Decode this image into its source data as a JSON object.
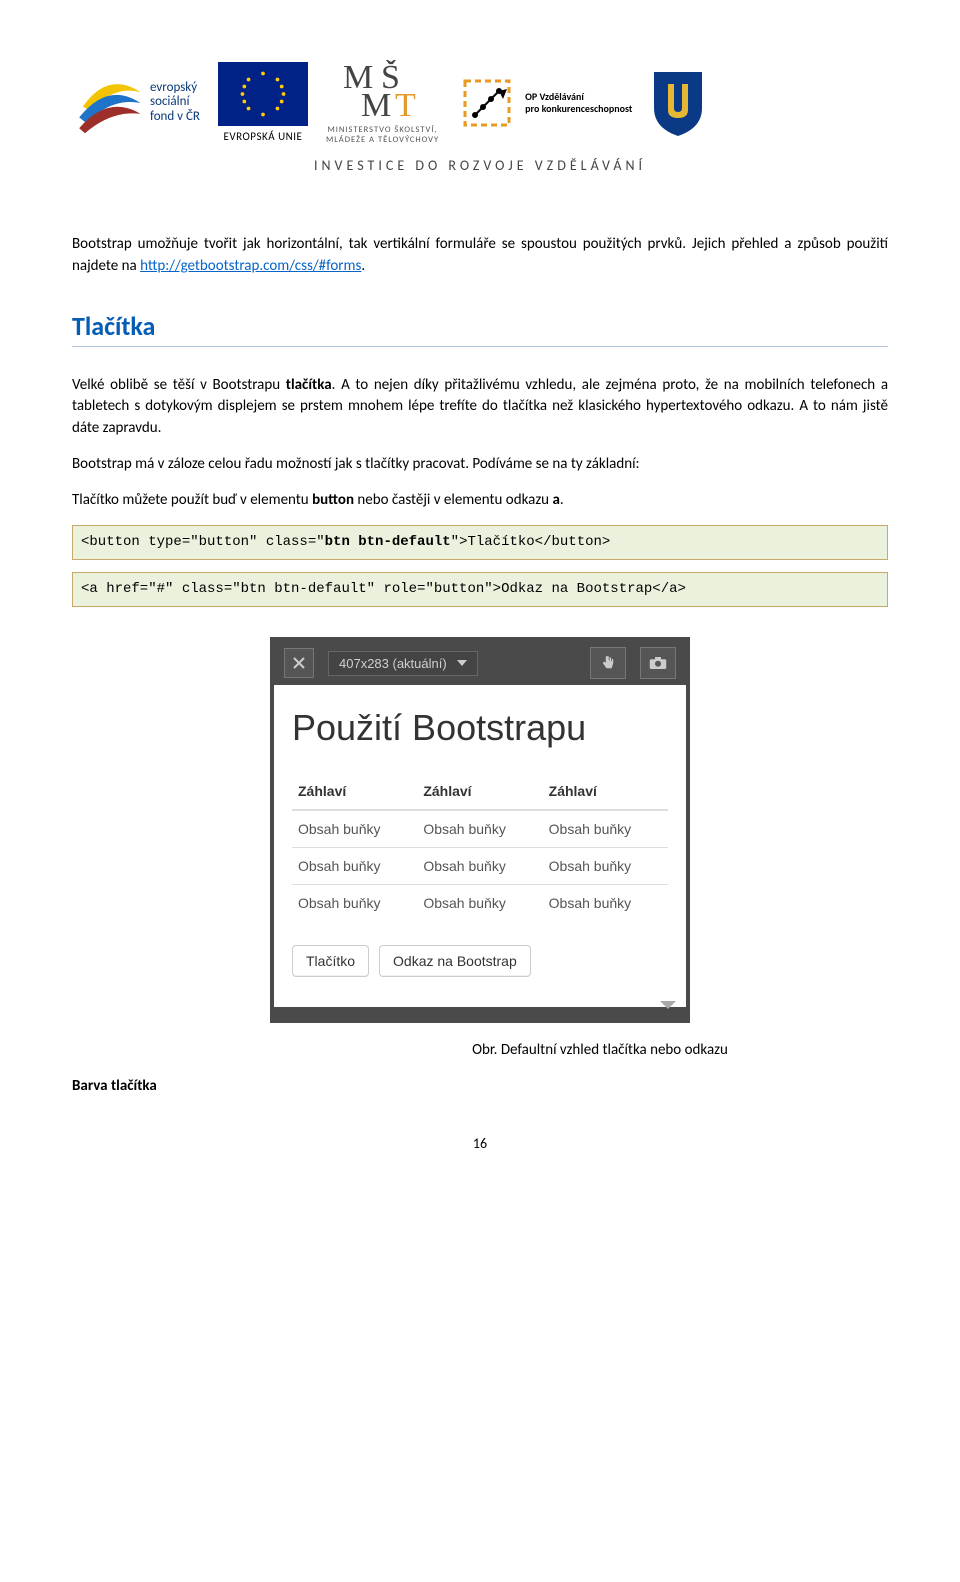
{
  "header": {
    "esf": {
      "line1": "evropský",
      "line2": "sociální",
      "line3": "fond v ČR"
    },
    "eu_label": "EVROPSKÁ UNIE",
    "msmt": {
      "line1": "MINISTERSTVO ŠKOLSTVÍ,",
      "line2": "MLÁDEŽE A TĚLOVÝCHOVY"
    },
    "op": {
      "line1": "OP Vzdělávání",
      "line2": "pro konkurenceschopnost"
    },
    "invest": "INVESTICE DO ROZVOJE VZDĚLÁVÁNÍ"
  },
  "intro": {
    "p1a": "Bootstrap umožňuje tvořit jak horizontální, tak vertikální formuláře se spoustou použitých prvků. Jejich přehled a způsob použití najdete na ",
    "link_text": "http://getbootstrap.com/css/#forms",
    "p1b": "."
  },
  "tlacitka_heading": "Tlačítka",
  "body": {
    "p2a": "Velké oblibě se těší v Bootstrapu ",
    "p2bold": "tlačítka",
    "p2b": ". A to nejen díky přitažlivému vzhledu, ale zejména proto, že na mobilních telefonech a tabletech s dotykovým displejem se prstem mnohem lépe trefíte do tlačítka než klasického hypertextového odkazu. A to nám jistě dáte zapravdu.",
    "p3": "Bootstrap má v záloze celou řadu možností jak s tlačítky pracovat. Podíváme se na ty základní:",
    "p4a": "Tlačítko můžete použít buď v elementu ",
    "p4bold1": "button",
    "p4mid": " nebo častěji v elementu odkazu ",
    "p4bold2": "a",
    "p4end": "."
  },
  "code1": "<button type=\"button\" class=\"btn btn-default\">Tlačítko</button>",
  "code1_bold": "btn btn-default",
  "code2": "<a href=\"#\" class=\"btn btn-default\" role=\"button\">Odkaz na Bootstrap</a>",
  "screenshot": {
    "resolution": "407x283 (aktuální)",
    "title": "Použití Bootstrapu",
    "table_header": "Záhlaví",
    "table_cell": "Obsah buňky",
    "btn1": "Tlačítko",
    "btn2": "Odkaz na Bootstrap"
  },
  "caption": "Obr. Defaultní vzhled tlačítka nebo odkazu",
  "subheading": "Barva tlačítka",
  "page_number": "16"
}
